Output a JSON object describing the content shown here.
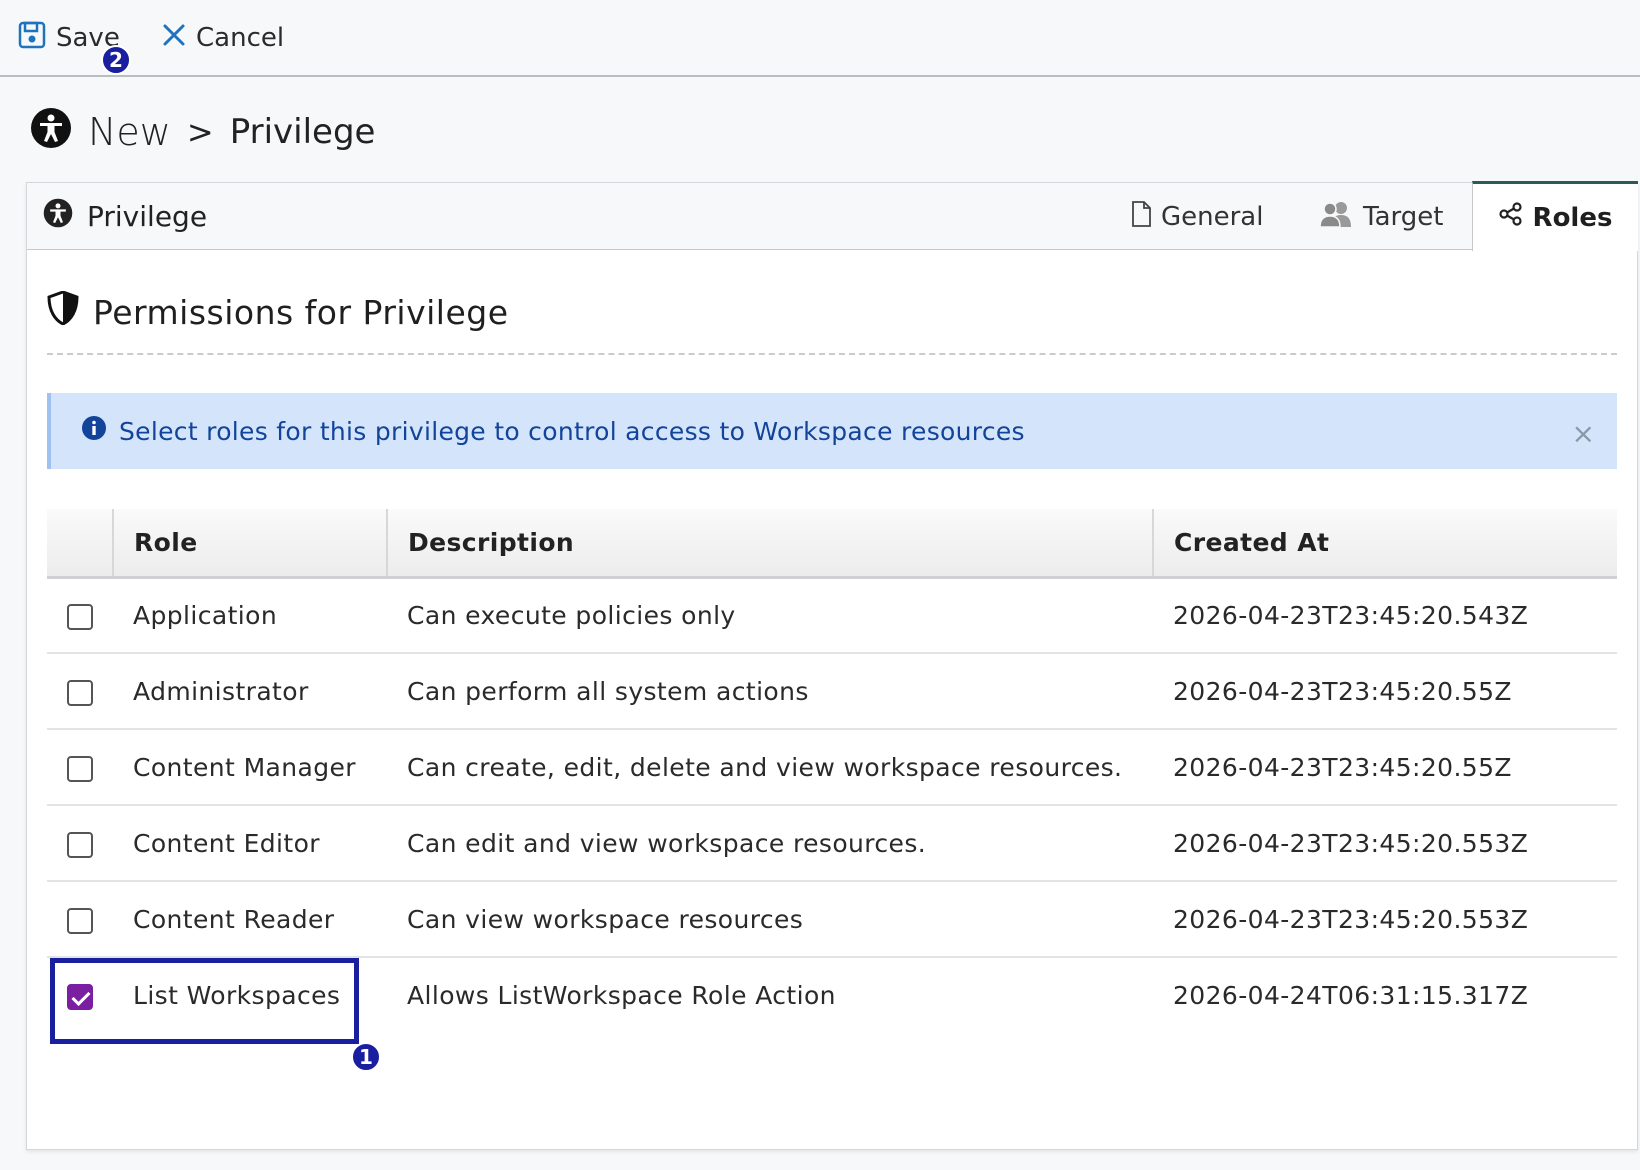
{
  "toolbar": {
    "save_label": "Save",
    "cancel_label": "Cancel",
    "save_badge": "2"
  },
  "breadcrumb": {
    "new": "New",
    "separator": ">",
    "current": "Privilege"
  },
  "card": {
    "title": "Privilege",
    "tabs": [
      {
        "label": "General",
        "icon": "file-icon"
      },
      {
        "label": "Target",
        "icon": "users-icon"
      },
      {
        "label": "Roles",
        "icon": "share-icon",
        "active": true
      }
    ]
  },
  "section": {
    "title": "Permissions for Privilege",
    "info_message": "Select roles for this privilege to control access to Workspace resources",
    "close_symbol": "×"
  },
  "table": {
    "headers": [
      "Role",
      "Description",
      "Created At"
    ],
    "rows": [
      {
        "checked": false,
        "role": "Application",
        "description": "Can execute policies only",
        "created_at": "2026-04-23T23:45:20.543Z"
      },
      {
        "checked": false,
        "role": "Administrator",
        "description": "Can perform all system actions",
        "created_at": "2026-04-23T23:45:20.55Z"
      },
      {
        "checked": false,
        "role": "Content Manager",
        "description": "Can create, edit, delete and view workspace resources.",
        "created_at": "2026-04-23T23:45:20.55Z"
      },
      {
        "checked": false,
        "role": "Content Editor",
        "description": "Can edit and view workspace resources.",
        "created_at": "2026-04-23T23:45:20.553Z"
      },
      {
        "checked": false,
        "role": "Content Reader",
        "description": "Can view workspace resources",
        "created_at": "2026-04-23T23:45:20.553Z"
      },
      {
        "checked": true,
        "role": "List Workspaces",
        "description": "Allows ListWorkspace Role Action",
        "created_at": "2026-04-24T06:31:15.317Z"
      }
    ]
  },
  "annotation": {
    "highlight_badge": "1"
  },
  "colors": {
    "accent_badge": "#1a1fa0",
    "checkbox_checked": "#7b1fa2",
    "info_bg": "#d4e4fb",
    "info_text": "#12449a",
    "save_icon": "#1e73be",
    "cancel_icon": "#1e73be"
  }
}
